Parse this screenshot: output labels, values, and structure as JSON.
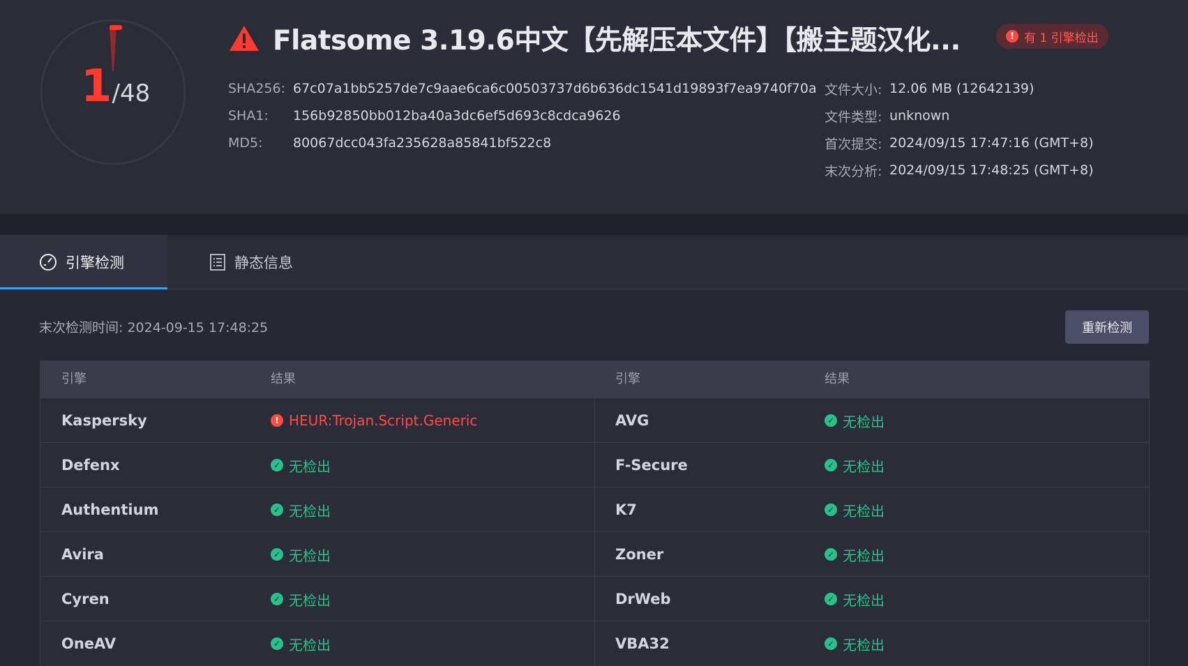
{
  "summary": {
    "detections": "1",
    "total": "/48",
    "detection_ratio": 0.0208
  },
  "file": {
    "title": "Flatsome 3.19.6中文【先解压本文件】【搬主题汉化...",
    "detect_badge": "有 1 引擎检出",
    "hashes": [
      {
        "key": "SHA256:",
        "value": "67c07a1bb5257de7c9aae6ca6c00503737d6b636dc1541d19893f7ea9740f70a"
      },
      {
        "key": "SHA1:",
        "value": "156b92850bb012ba40a3dc6ef5d693c8cdca9626"
      },
      {
        "key": "MD5:",
        "value": "80067dcc043fa235628a85841bf522c8"
      }
    ],
    "meta": [
      {
        "key": "文件大小:",
        "value": "12.06 MB (12642139)"
      },
      {
        "key": "文件类型:",
        "value": "unknown"
      },
      {
        "key": "首次提交:",
        "value": "2024/09/15 17:47:16 (GMT+8)"
      },
      {
        "key": "末次分析:",
        "value": "2024/09/15 17:48:25 (GMT+8)"
      }
    ]
  },
  "tabs": [
    {
      "label": "引擎检测",
      "icon": "gauge-icon",
      "active": true
    },
    {
      "label": "静态信息",
      "icon": "document-list-icon",
      "active": false
    }
  ],
  "scan": {
    "last_check": "末次检测时间: 2024-09-15 17:48:25",
    "recheck_button": "重新检测"
  },
  "table": {
    "headers": [
      "引擎",
      "结果",
      "引擎",
      "结果"
    ],
    "rows": [
      {
        "left": {
          "engine": "Kaspersky",
          "result": "HEUR:Trojan.Script.Generic",
          "status": "detected"
        },
        "right": {
          "engine": "AVG",
          "result": "无检出",
          "status": "clean"
        }
      },
      {
        "left": {
          "engine": "Defenx",
          "result": "无检出",
          "status": "clean"
        },
        "right": {
          "engine": "F-Secure",
          "result": "无检出",
          "status": "clean"
        }
      },
      {
        "left": {
          "engine": "Authentium",
          "result": "无检出",
          "status": "clean"
        },
        "right": {
          "engine": "K7",
          "result": "无检出",
          "status": "clean"
        }
      },
      {
        "left": {
          "engine": "Avira",
          "result": "无检出",
          "status": "clean"
        },
        "right": {
          "engine": "Zoner",
          "result": "无检出",
          "status": "clean"
        }
      },
      {
        "left": {
          "engine": "Cyren",
          "result": "无检出",
          "status": "clean"
        },
        "right": {
          "engine": "DrWeb",
          "result": "无检出",
          "status": "clean"
        }
      },
      {
        "left": {
          "engine": "OneAV",
          "result": "无检出",
          "status": "clean"
        },
        "right": {
          "engine": "VBA32",
          "result": "无检出",
          "status": "clean"
        }
      }
    ]
  },
  "colors": {
    "background": "#262834",
    "danger": "#ff4b44",
    "clean": "#25c28a",
    "accent": "#3aa0f0"
  }
}
